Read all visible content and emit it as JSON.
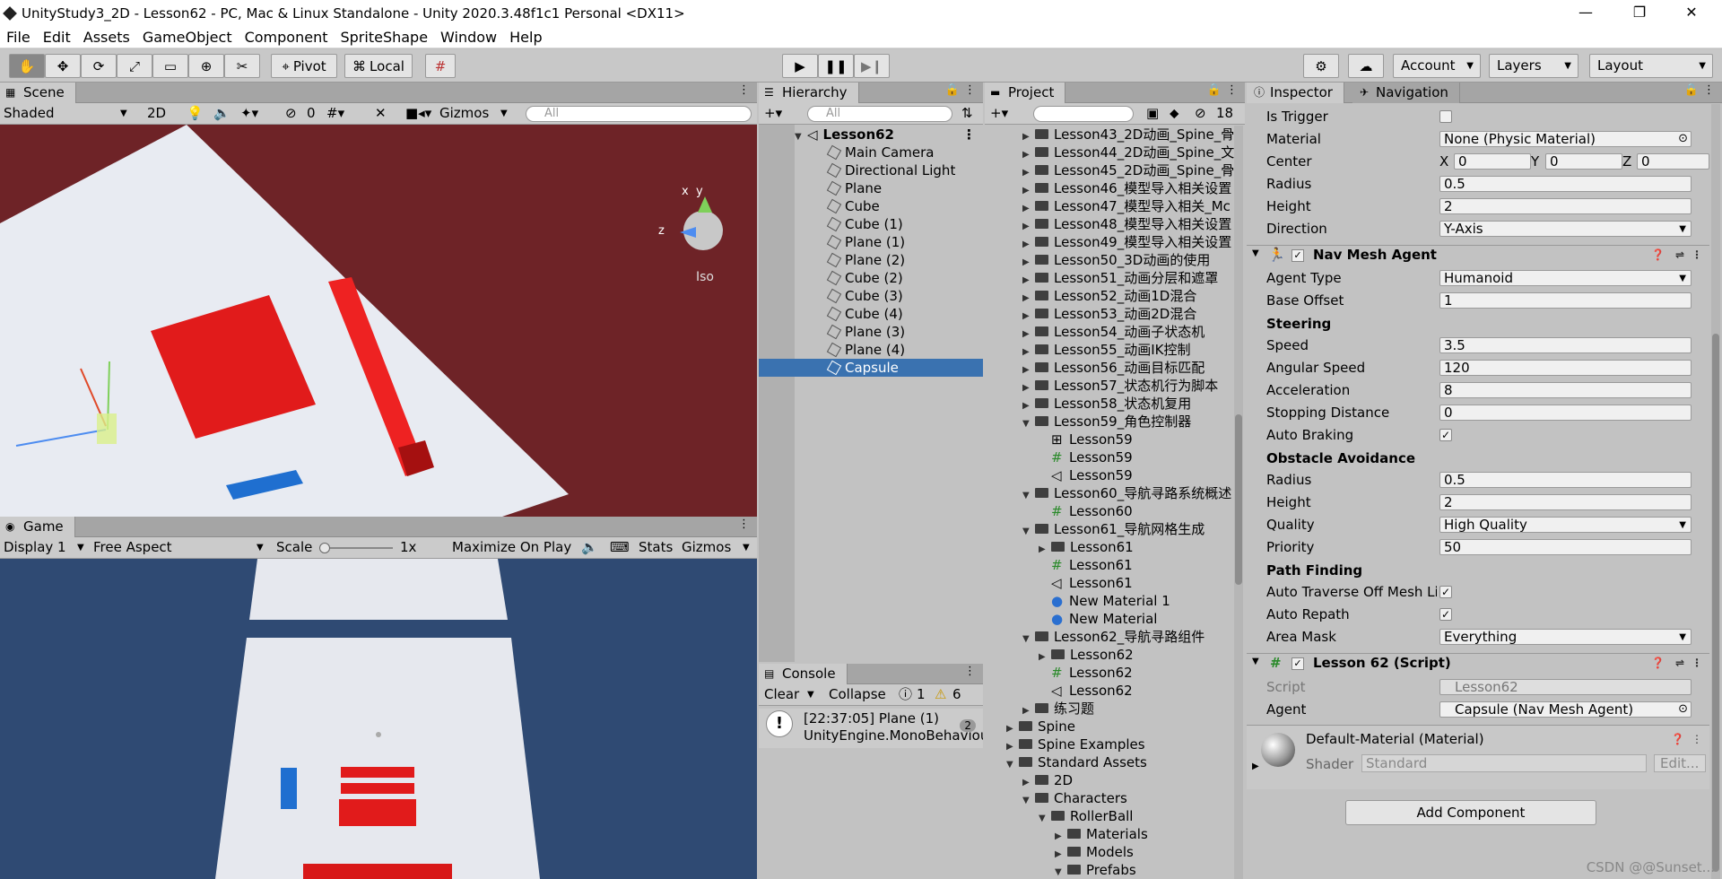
{
  "window": {
    "title": "UnityStudy3_2D - Lesson62 - PC, Mac & Linux Standalone - Unity 2020.3.48f1c1 Personal <DX11>"
  },
  "menu": [
    "File",
    "Edit",
    "Assets",
    "GameObject",
    "Component",
    "SpriteShape",
    "Window",
    "Help"
  ],
  "toolbar": {
    "pivot": "Pivot",
    "local": "Local",
    "account": "Account",
    "layers": "Layers",
    "layout": "Layout"
  },
  "scene": {
    "tab": "Scene",
    "shading": "Shaded",
    "mode2d": "2D",
    "hidden_count": "0",
    "gizmos": "Gizmos",
    "search_placeholder": "All",
    "iso": "Iso",
    "axis_x": "x",
    "axis_y": "y",
    "axis_z": "z",
    "bg": "#6e2327"
  },
  "game": {
    "tab": "Game",
    "display": "Display 1",
    "aspect": "Free Aspect",
    "scale_label": "Scale",
    "scale_value": "1x",
    "maximize": "Maximize On Play",
    "stats": "Stats",
    "gizmos": "Gizmos",
    "bg": "#2f4a73"
  },
  "hierarchy": {
    "tab": "Hierarchy",
    "search_placeholder": "All",
    "scene": "Lesson62",
    "items": [
      "Main Camera",
      "Directional Light",
      "Plane",
      "Cube",
      "Cube (1)",
      "Plane (1)",
      "Plane (2)",
      "Cube (2)",
      "Cube (3)",
      "Cube (4)",
      "Plane (3)",
      "Plane (4)",
      "Capsule"
    ],
    "selected": "Capsule",
    "selection_color": "#3a72b0"
  },
  "console": {
    "tab": "Console",
    "clear": "Clear",
    "collapse": "Collapse",
    "info_count": "1",
    "warn_count": "6",
    "message_line1": "[22:37:05] Plane (1)",
    "message_line2": "UnityEngine.MonoBehaviour",
    "message_count": "2"
  },
  "project": {
    "tab": "Project",
    "hidden_count": "18",
    "items": [
      {
        "label": "Lesson43_2D动画_Spine_骨",
        "indent": 0,
        "type": "folder",
        "arrow": "right"
      },
      {
        "label": "Lesson44_2D动画_Spine_文",
        "indent": 0,
        "type": "folder",
        "arrow": "right"
      },
      {
        "label": "Lesson45_2D动画_Spine_骨",
        "indent": 0,
        "type": "folder",
        "arrow": "right"
      },
      {
        "label": "Lesson46_模型导入相关设置",
        "indent": 0,
        "type": "folder",
        "arrow": "right"
      },
      {
        "label": "Lesson47_模型导入相关_Mc",
        "indent": 0,
        "type": "folder",
        "arrow": "right"
      },
      {
        "label": "Lesson48_模型导入相关设置",
        "indent": 0,
        "type": "folder",
        "arrow": "right"
      },
      {
        "label": "Lesson49_模型导入相关设置",
        "indent": 0,
        "type": "folder",
        "arrow": "right"
      },
      {
        "label": "Lesson50_3D动画的使用",
        "indent": 0,
        "type": "folder",
        "arrow": "right"
      },
      {
        "label": "Lesson51_动画分层和遮罩",
        "indent": 0,
        "type": "folder",
        "arrow": "right"
      },
      {
        "label": "Lesson52_动画1D混合",
        "indent": 0,
        "type": "folder",
        "arrow": "right"
      },
      {
        "label": "Lesson53_动画2D混合",
        "indent": 0,
        "type": "folder",
        "arrow": "right"
      },
      {
        "label": "Lesson54_动画子状态机",
        "indent": 0,
        "type": "folder",
        "arrow": "right"
      },
      {
        "label": "Lesson55_动画IK控制",
        "indent": 0,
        "type": "folder",
        "arrow": "right"
      },
      {
        "label": "Lesson56_动画目标匹配",
        "indent": 0,
        "type": "folder",
        "arrow": "right"
      },
      {
        "label": "Lesson57_状态机行为脚本",
        "indent": 0,
        "type": "folder",
        "arrow": "right"
      },
      {
        "label": "Lesson58_状态机复用",
        "indent": 0,
        "type": "folder",
        "arrow": "right"
      },
      {
        "label": "Lesson59_角色控制器",
        "indent": 0,
        "type": "folder",
        "arrow": "down"
      },
      {
        "label": "Lesson59",
        "indent": 1,
        "type": "controller",
        "arrow": ""
      },
      {
        "label": "Lesson59",
        "indent": 1,
        "type": "script",
        "arrow": ""
      },
      {
        "label": "Lesson59",
        "indent": 1,
        "type": "scene",
        "arrow": ""
      },
      {
        "label": "Lesson60_导航寻路系统概述",
        "indent": 0,
        "type": "folder",
        "arrow": "down"
      },
      {
        "label": "Lesson60",
        "indent": 1,
        "type": "script",
        "arrow": ""
      },
      {
        "label": "Lesson61_导航网格生成",
        "indent": 0,
        "type": "folder",
        "arrow": "down"
      },
      {
        "label": "Lesson61",
        "indent": 1,
        "type": "folder",
        "arrow": "right"
      },
      {
        "label": "Lesson61",
        "indent": 1,
        "type": "script",
        "arrow": ""
      },
      {
        "label": "Lesson61",
        "indent": 1,
        "type": "scene",
        "arrow": ""
      },
      {
        "label": "New Material 1",
        "indent": 1,
        "type": "material",
        "arrow": ""
      },
      {
        "label": "New Material",
        "indent": 1,
        "type": "material",
        "arrow": ""
      },
      {
        "label": "Lesson62_导航寻路组件",
        "indent": 0,
        "type": "folder",
        "arrow": "down"
      },
      {
        "label": "Lesson62",
        "indent": 1,
        "type": "folder",
        "arrow": "right"
      },
      {
        "label": "Lesson62",
        "indent": 1,
        "type": "script",
        "arrow": ""
      },
      {
        "label": "Lesson62",
        "indent": 1,
        "type": "scene",
        "arrow": ""
      },
      {
        "label": "练习题",
        "indent": 0,
        "type": "folder",
        "arrow": "right"
      },
      {
        "label": "Spine",
        "indent": -1,
        "type": "folder",
        "arrow": "right"
      },
      {
        "label": "Spine Examples",
        "indent": -1,
        "type": "folder",
        "arrow": "right"
      },
      {
        "label": "Standard Assets",
        "indent": -1,
        "type": "folder",
        "arrow": "down"
      },
      {
        "label": "2D",
        "indent": 0,
        "type": "folder",
        "arrow": "right"
      },
      {
        "label": "Characters",
        "indent": 0,
        "type": "folder",
        "arrow": "down"
      },
      {
        "label": "RollerBall",
        "indent": 1,
        "type": "folder",
        "arrow": "down"
      },
      {
        "label": "Materials",
        "indent": 2,
        "type": "folder",
        "arrow": "right"
      },
      {
        "label": "Models",
        "indent": 2,
        "type": "folder",
        "arrow": "right"
      },
      {
        "label": "Prefabs",
        "indent": 2,
        "type": "folder",
        "arrow": "down"
      }
    ]
  },
  "inspector": {
    "tab": "Inspector",
    "tab2": "Navigation",
    "collider": {
      "is_trigger": "Is Trigger",
      "material_label": "Material",
      "material_value": "None (Physic Material)",
      "center_label": "Center",
      "cx": "X",
      "cxv": "0",
      "cy": "Y",
      "cyv": "0",
      "cz": "Z",
      "czv": "0",
      "radius_label": "Radius",
      "radius": "0.5",
      "height_label": "Height",
      "height": "2",
      "direction_label": "Direction",
      "direction": "Y-Axis"
    },
    "navmesh": {
      "title": "Nav Mesh Agent",
      "agent_type_label": "Agent Type",
      "agent_type": "Humanoid",
      "base_offset_label": "Base Offset",
      "base_offset": "1",
      "steering": "Steering",
      "speed_label": "Speed",
      "speed": "3.5",
      "angular_label": "Angular Speed",
      "angular": "120",
      "accel_label": "Acceleration",
      "accel": "8",
      "stopping_label": "Stopping Distance",
      "stopping": "0",
      "auto_braking": "Auto Braking",
      "obstacle": "Obstacle Avoidance",
      "o_radius_label": "Radius",
      "o_radius": "0.5",
      "o_height_label": "Height",
      "o_height": "2",
      "quality_label": "Quality",
      "quality": "High Quality",
      "priority_label": "Priority",
      "priority": "50",
      "path": "Path Finding",
      "auto_traverse": "Auto Traverse Off Mesh Li",
      "auto_repath": "Auto Repath",
      "area_label": "Area Mask",
      "area": "Everything"
    },
    "script": {
      "title": "Lesson 62 (Script)",
      "script_label": "Script",
      "script_value": "Lesson62",
      "agent_label": "Agent",
      "agent_value": "Capsule (Nav Mesh Agent)"
    },
    "material": {
      "title": "Default-Material (Material)",
      "shader_label": "Shader",
      "shader": "Standard",
      "edit": "Edit..."
    },
    "add_component": "Add Component"
  },
  "watermark": "CSDN @@Sunset..."
}
